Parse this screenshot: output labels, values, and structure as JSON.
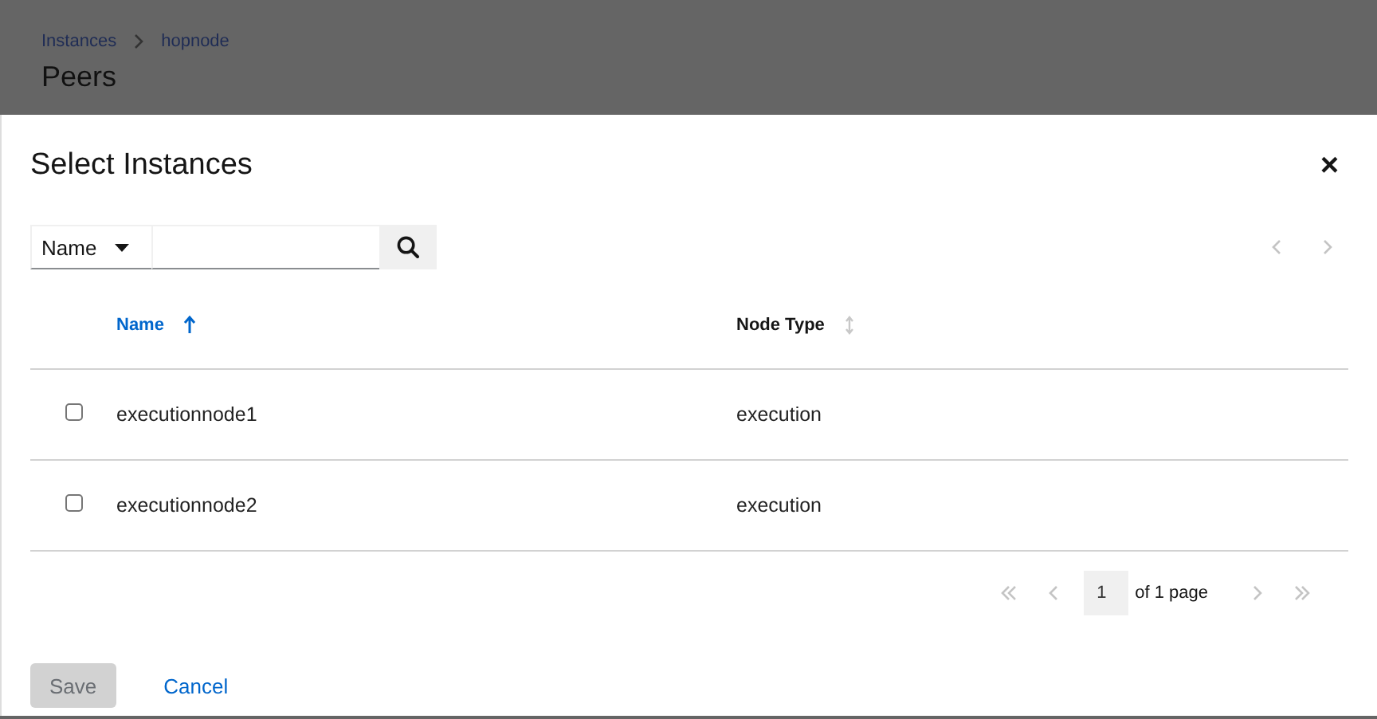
{
  "backdrop": {
    "breadcrumbs": [
      {
        "label": "Instances"
      },
      {
        "label": "hopnode"
      }
    ],
    "title": "Peers"
  },
  "modal": {
    "title": "Select Instances",
    "close": "×",
    "filter": {
      "field": "Name"
    },
    "top_pagination": {
      "prev_disabled": true,
      "next_disabled": true
    },
    "columns": [
      {
        "label": "Name",
        "sorted": true
      },
      {
        "label": "Node Type",
        "sorted": false
      }
    ],
    "rows": [
      {
        "checked": false,
        "cells": [
          "executionnode1",
          "execution"
        ]
      },
      {
        "checked": false,
        "cells": [
          "executionnode2",
          "execution"
        ]
      }
    ],
    "pagination": {
      "page": "1",
      "total": "of 1 page",
      "first_disabled": true,
      "prev_disabled": true,
      "next_disabled": true,
      "last_disabled": true
    },
    "buttons": [
      {
        "kind": "primary",
        "label": "Save",
        "disabled": true
      },
      {
        "kind": "link",
        "label": "Cancel",
        "disabled": false
      }
    ]
  }
}
